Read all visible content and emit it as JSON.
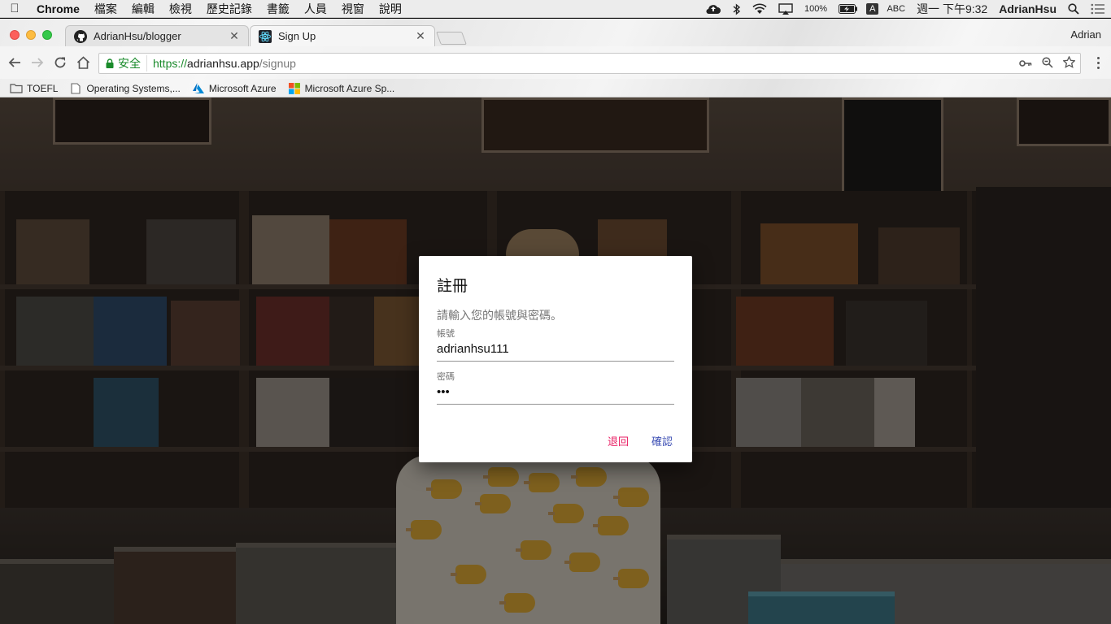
{
  "menubar": {
    "app": "Chrome",
    "items": [
      "檔案",
      "編輯",
      "檢視",
      "歷史記錄",
      "書籤",
      "人員",
      "視窗",
      "說明"
    ],
    "battery": "100%",
    "input_method_badge": "A",
    "input_method": "ABC",
    "clock": "週一 下午9:32",
    "user": "AdrianHsu"
  },
  "tabs": [
    {
      "title": "AdrianHsu/blogger",
      "icon": "github-icon"
    },
    {
      "title": "Sign Up",
      "icon": "react-icon"
    }
  ],
  "profile": "Adrian",
  "omnibox": {
    "secure_label": "安全",
    "scheme": "https://",
    "host": "adrianhsu.app",
    "path": "/signup"
  },
  "bookmarks": [
    {
      "label": "TOEFL",
      "icon": "folder-icon"
    },
    {
      "label": "Operating Systems,...",
      "icon": "page-icon"
    },
    {
      "label": "Microsoft Azure",
      "icon": "azure-icon"
    },
    {
      "label": "Microsoft Azure Sp...",
      "icon": "microsoft-icon"
    }
  ],
  "dialog": {
    "title": "註冊",
    "description": "請輸入您的帳號與密碼。",
    "username_label": "帳號",
    "username_value": "adrianhsu111",
    "password_label": "密碼",
    "password_value": "•••",
    "back_label": "退回",
    "confirm_label": "確認"
  },
  "colors": {
    "back_button": "#e91e63",
    "confirm_button": "#3f51b5",
    "secure_green": "#1a8b2b"
  }
}
